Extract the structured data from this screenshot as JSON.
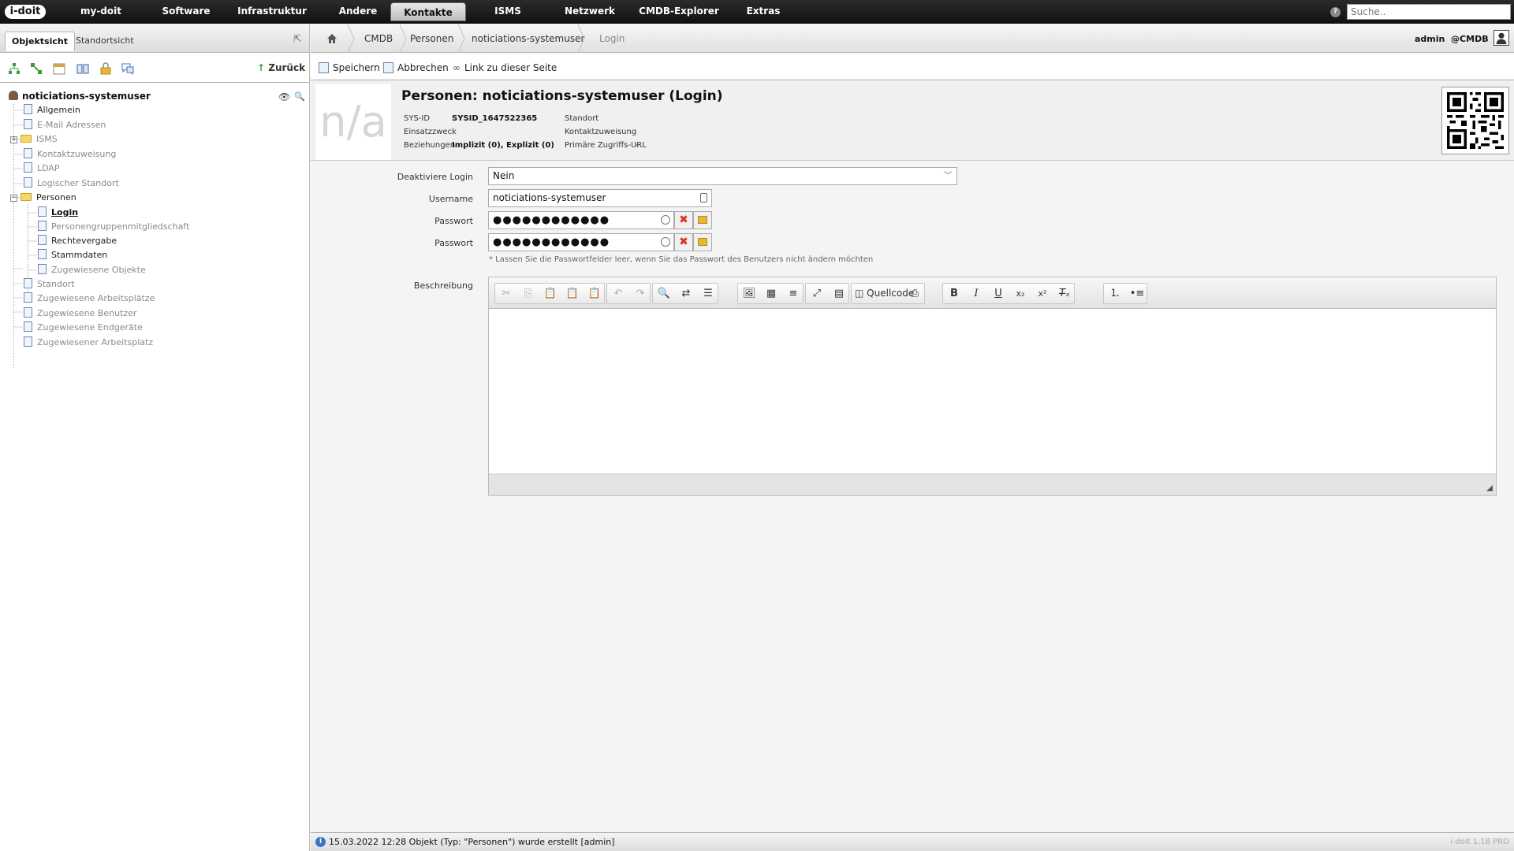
{
  "app": {
    "logo": "i-doit"
  },
  "nav": {
    "items": [
      "my-doit",
      "Software",
      "Infrastruktur",
      "Andere",
      "Kontakte",
      "ISMS",
      "Netzwerk",
      "CMDB-Explorer",
      "Extras"
    ],
    "active": "Kontakte",
    "search_placeholder": "Suche.."
  },
  "left": {
    "tabs": [
      "Objektsicht",
      "Standortsicht"
    ],
    "back_label": "Zurück",
    "root": "noticiations-systemuser",
    "tree": [
      "Allgemein",
      "E-Mail Adressen",
      "ISMS",
      "Kontaktzuweisung",
      "LDAP",
      "Logischer Standort",
      "Personen",
      "Login",
      "Personengruppenmitgliedschaft",
      "Rechtevergabe",
      "Stammdaten",
      "Zugewiesene Objekte",
      "Standort",
      "Zugewiesene Arbeitsplätze",
      "Zugewiesene Benutzer",
      "Zugewiesene Endgeräte",
      "Zugewiesener Arbeitsplatz"
    ]
  },
  "breadcrumb": {
    "items": [
      "CMDB",
      "Personen",
      "noticiations-systemuser",
      "Login"
    ]
  },
  "user": {
    "name": "admin",
    "tenant": "@CMDB"
  },
  "actions": {
    "save": "Speichern",
    "cancel": "Abbrechen",
    "link": "Link zu dieser Seite"
  },
  "header": {
    "na": "n/a",
    "title": "Personen: noticiations-systemuser (Login)",
    "sysid_label": "SYS-ID",
    "sysid_value": "SYSID_1647522365",
    "purpose_label": "Einsatzzweck",
    "relations_label": "Beziehungen",
    "relations_value": "Implizit (0), Explizit (0)",
    "location_label": "Standort",
    "contact_label": "Kontaktzuweisung",
    "url_label": "Primäre Zugriffs-URL",
    "url_value": "-"
  },
  "form": {
    "deactivate_label": "Deaktiviere Login",
    "deactivate_value": "Nein",
    "username_label": "Username",
    "username_value": "noticiations-systemuser",
    "password_label": "Passwort",
    "password_value": "●●●●●●●●●●●●",
    "password2_label": "Passwort",
    "password2_value": "●●●●●●●●●●●●",
    "hint": "* Lassen Sie die Passwortfelder leer, wenn Sie das Passwort des Benutzers nicht ändern möchten",
    "description_label": "Beschreibung"
  },
  "editor": {
    "source_label": "Quellcode"
  },
  "status": {
    "message": "15.03.2022 12:28 Objekt (Typ: \"Personen\") wurde erstellt [admin]",
    "version": "i-doit 1.18 PRO"
  }
}
